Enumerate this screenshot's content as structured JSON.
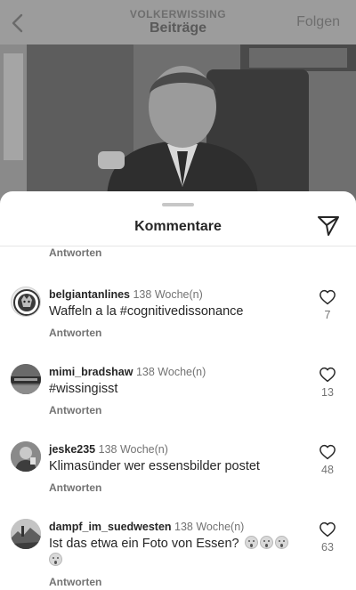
{
  "header": {
    "account": "VOLKERWISSING",
    "title": "Beiträge",
    "follow_label": "Folgen"
  },
  "sheet": {
    "title": "Kommentare",
    "reply_label_top": "Antworten"
  },
  "comments": [
    {
      "username": "belgiantanlines",
      "time": "138 Woche(n)",
      "text": "Waffeln a la #cognitivedissonance",
      "reply_label": "Antworten",
      "likes": "7"
    },
    {
      "username": "mimi_bradshaw",
      "time": "138 Woche(n)",
      "text": "#wissingisst",
      "reply_label": "Antworten",
      "likes": "13"
    },
    {
      "username": "jeske235",
      "time": "138 Woche(n)",
      "text": "Klimasünder wer essensbilder postet",
      "reply_label": "Antworten",
      "likes": "48"
    },
    {
      "username": "dampf_im_suedwesten",
      "time": "138 Woche(n)",
      "text": "Ist das etwa ein Foto von Essen?",
      "reply_label": "Antworten",
      "likes": "63"
    }
  ]
}
